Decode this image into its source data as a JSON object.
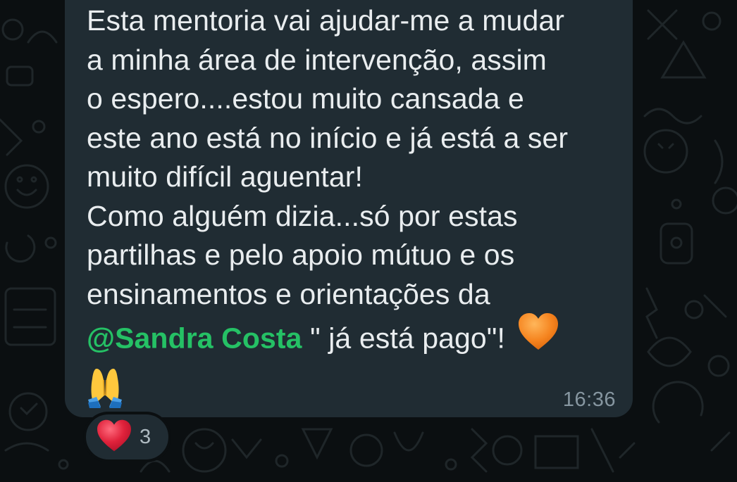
{
  "message": {
    "lines": [
      "Esta mentoria vai ajudar-me a mudar",
      "a minha área de intervenção,  assim",
      "o espero....estou muito cansada e",
      "este ano está no início e já está a ser",
      "muito difícil aguentar!",
      "Como alguém dizia...só por estas",
      "partilhas e pelo apoio mútuo e os",
      "ensinamentos e orientações da"
    ],
    "mention": "@Sandra Costa",
    "after_mention": " \" já está pago\"! ",
    "emoji_heart": "orange-heart-icon",
    "emoji_pray": "folded-hands-icon",
    "time": "16:36"
  },
  "reaction": {
    "emoji": "red-heart-icon",
    "count": "3"
  },
  "colors": {
    "bubble": "#202c33",
    "background": "#0b0f11",
    "text": "#e9edef",
    "mention": "#25c165",
    "time": "#8696a0",
    "orange_heart": "#f5841f",
    "red_heart": "#e0223b"
  }
}
